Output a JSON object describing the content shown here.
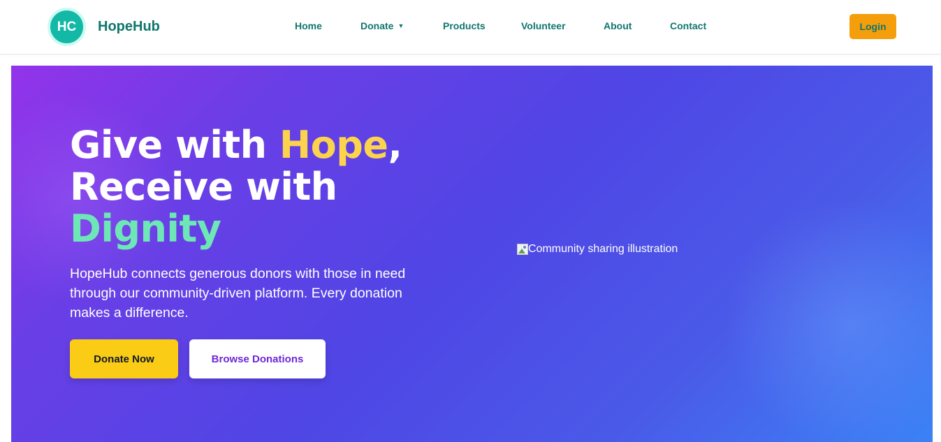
{
  "header": {
    "logo_initials": "HC",
    "brand": "HopeHub",
    "nav": [
      {
        "label": "Home"
      },
      {
        "label": "Donate",
        "dropdown": true
      },
      {
        "label": "Products"
      },
      {
        "label": "Volunteer"
      },
      {
        "label": "About"
      },
      {
        "label": "Contact"
      }
    ],
    "login_label": "Login"
  },
  "hero": {
    "headline_part1": "Give with ",
    "headline_hope": "Hope",
    "headline_comma": ",",
    "headline_part2": "Receive with",
    "headline_dignity": "Dignity",
    "subtitle": "HopeHub connects generous donors with those in need through our community-driven platform. Every donation makes a difference.",
    "primary_cta": "Donate Now",
    "secondary_cta": "Browse Donations",
    "image_alt": "Community sharing illustration"
  },
  "colors": {
    "brand_teal": "#14b8a6",
    "nav_text": "#0f766e",
    "login_bg": "#f59e0b",
    "hero_gradient_start": "#9333ea",
    "hero_gradient_end": "#3b82f6",
    "accent_yellow": "#fcd34d",
    "accent_green": "#6ee7b7",
    "cta_yellow": "#facc15",
    "cta_purple_text": "#6d28d9"
  },
  "icons": {
    "dropdown": "caret-down-icon",
    "broken_image": "broken-image-icon"
  }
}
